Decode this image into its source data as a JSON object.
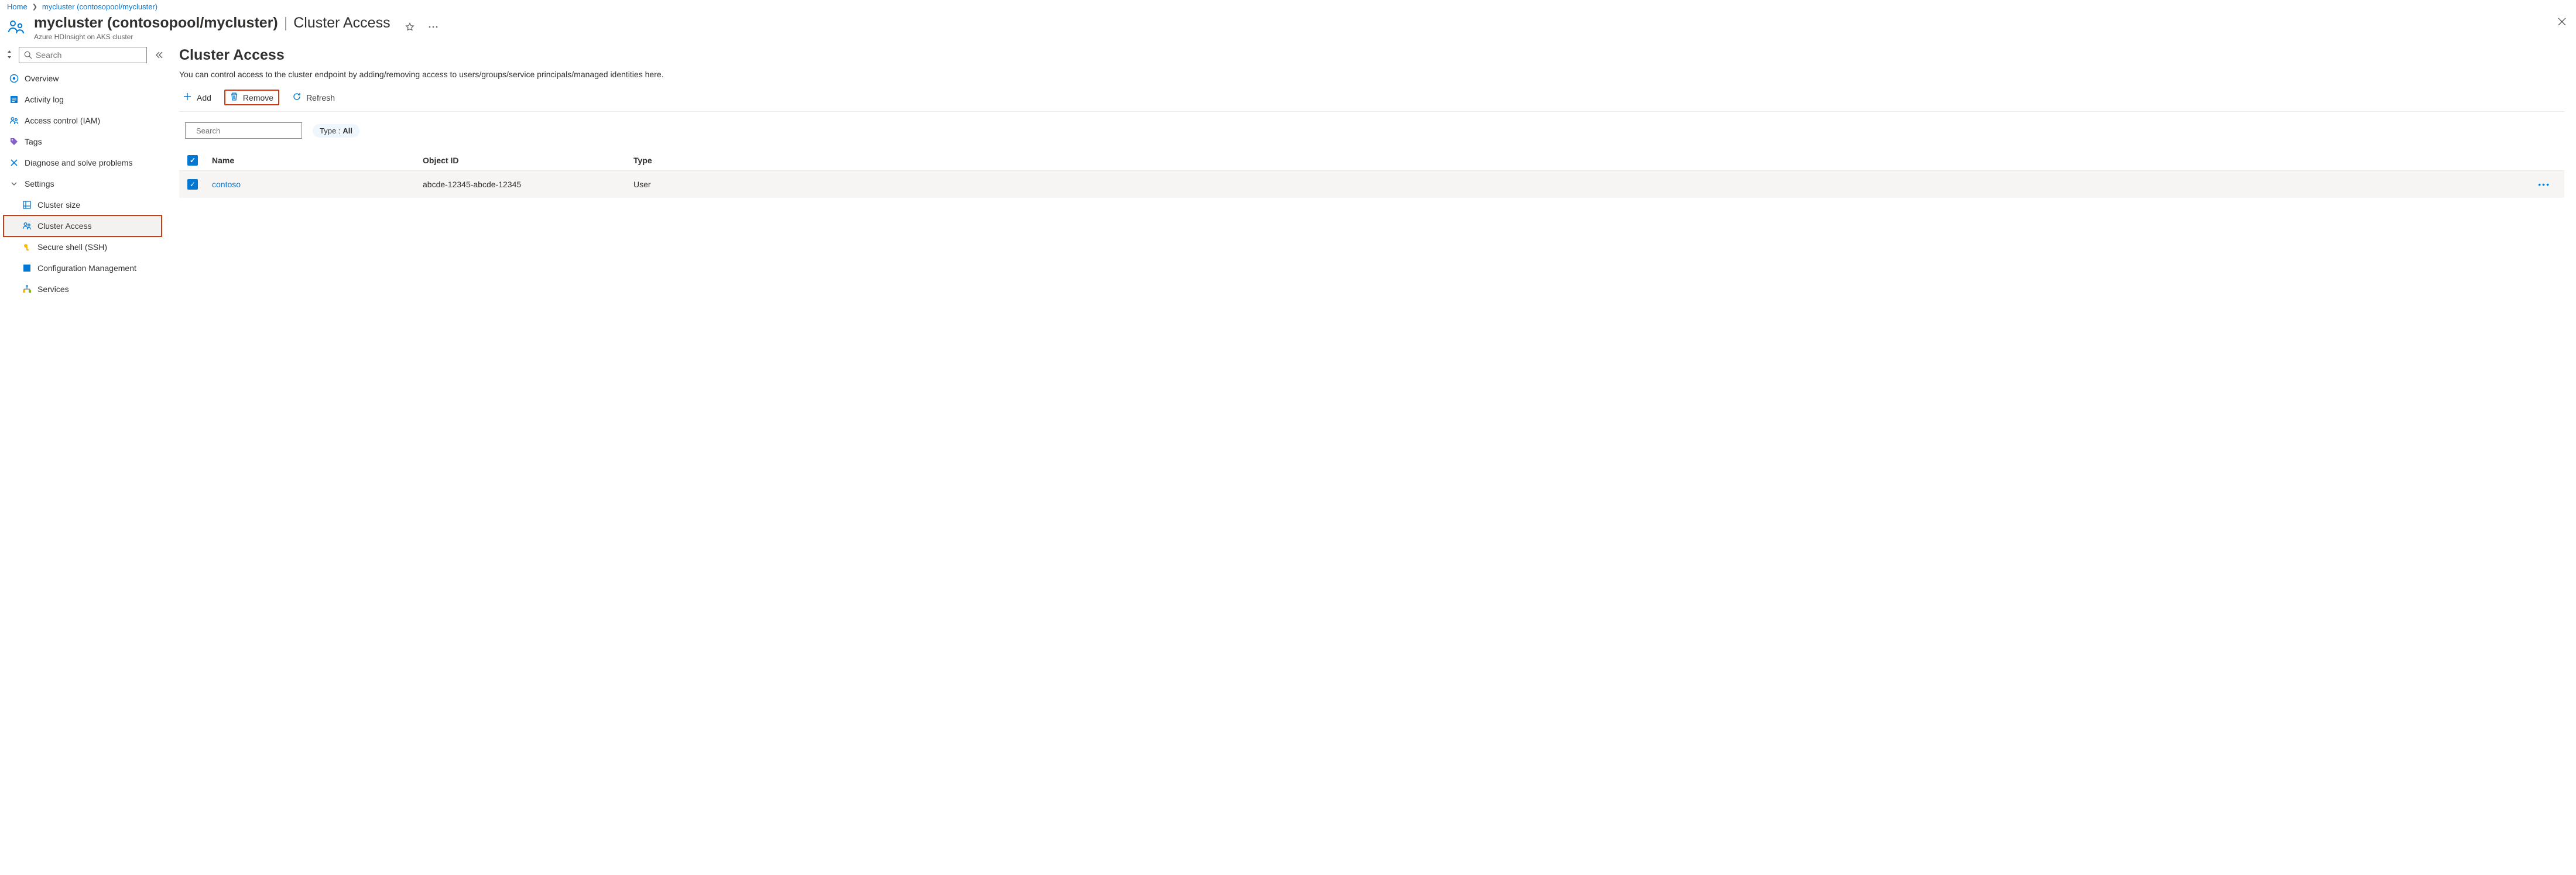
{
  "breadcrumb": {
    "home": "Home",
    "cluster": "mycluster (contosopool/mycluster)"
  },
  "header": {
    "title_main": "mycluster (contosopool/mycluster)",
    "title_section": "Cluster Access",
    "subtitle": "Azure HDInsight on AKS cluster"
  },
  "sidebar": {
    "search_placeholder": "Search",
    "items": {
      "overview": "Overview",
      "activity_log": "Activity log",
      "access_control": "Access control (IAM)",
      "tags": "Tags",
      "diagnose": "Diagnose and solve problems",
      "settings": "Settings",
      "cluster_size": "Cluster size",
      "cluster_access": "Cluster Access",
      "secure_shell": "Secure shell (SSH)",
      "config_mgmt": "Configuration Management",
      "services": "Services"
    }
  },
  "main": {
    "heading": "Cluster Access",
    "description": "You can control access to the cluster endpoint by adding/removing access to users/groups/service principals/managed identities here.",
    "toolbar": {
      "add": "Add",
      "remove": "Remove",
      "refresh": "Refresh"
    },
    "filter": {
      "search_placeholder": "Search",
      "pill_key": "Type :",
      "pill_value": "All"
    },
    "table": {
      "columns": {
        "name": "Name",
        "object_id": "Object ID",
        "type": "Type"
      },
      "rows": [
        {
          "name": "contoso",
          "object_id": "abcde-12345-abcde-12345",
          "type": "User"
        }
      ]
    }
  }
}
